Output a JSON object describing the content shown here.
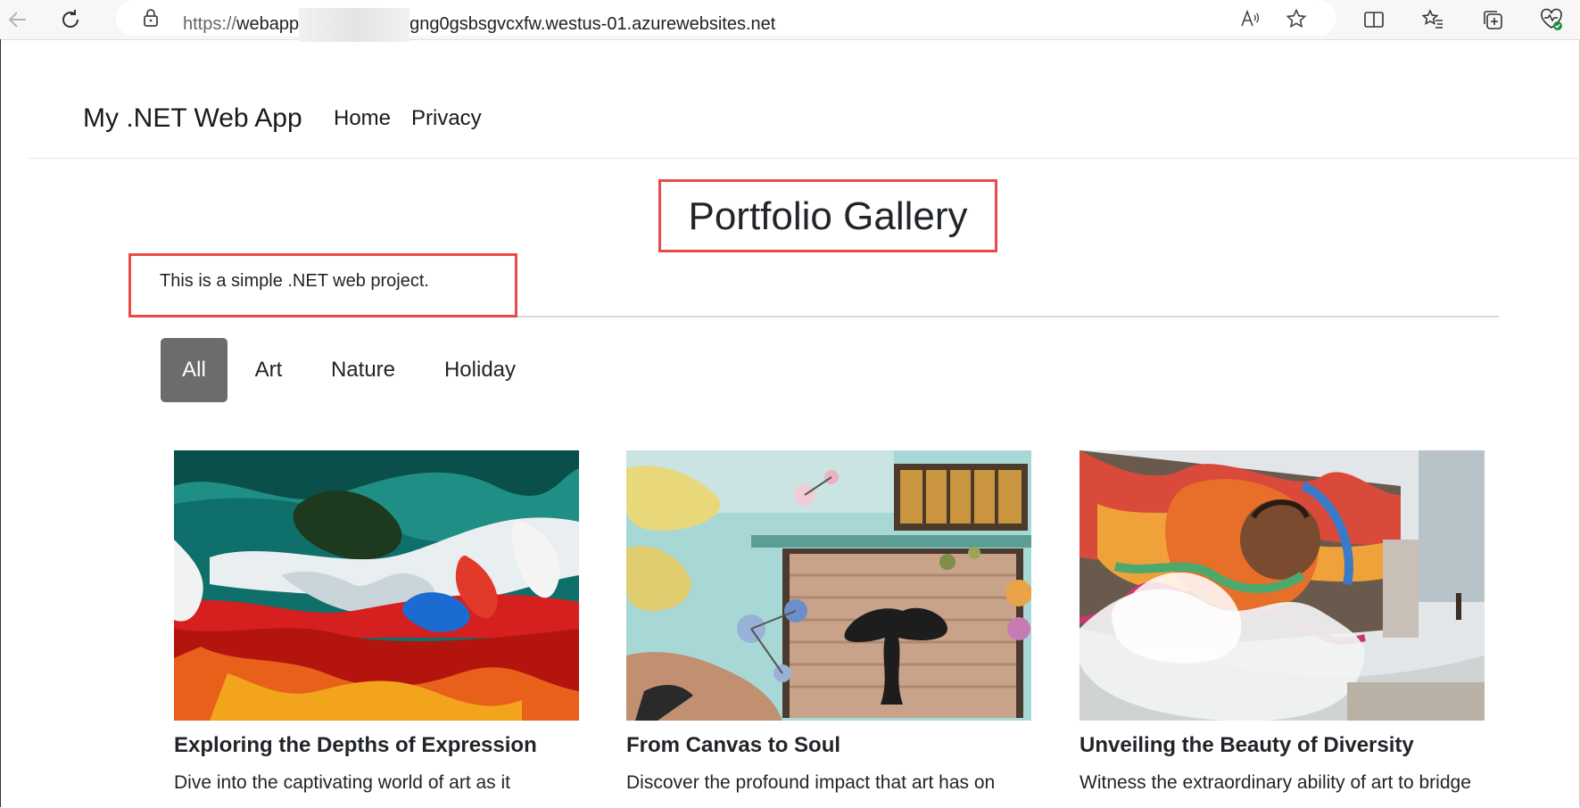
{
  "browser": {
    "url_protocol": "https://",
    "url_host_start": "webapp",
    "url_host_end": "gng0gsbsgvcxfw.westus-01.azurewebsites.net",
    "icons": [
      "back-icon",
      "refresh-icon",
      "lock-icon",
      "read-aloud-icon",
      "favorite-icon",
      "split-screen-icon",
      "favorites-icon",
      "collections-icon",
      "browser-essentials-icon"
    ]
  },
  "navbar": {
    "brand": "My .NET Web App",
    "links": [
      "Home",
      "Privacy"
    ]
  },
  "main": {
    "title": "Portfolio Gallery",
    "description": "This is a simple .NET web project."
  },
  "filters": {
    "items": [
      "All",
      "Art",
      "Nature",
      "Holiday"
    ],
    "active": "All"
  },
  "cards": [
    {
      "title": "Exploring the Depths of Expression",
      "text": "Dive into the captivating world of art as it",
      "image": "abstract-painting"
    },
    {
      "title": "From Canvas to Soul",
      "text": "Discover the profound impact that art has on",
      "image": "street-mural-garage"
    },
    {
      "title": "Unveiling the Beauty of Diversity",
      "text": "Witness the extraordinary ability of art to bridge",
      "image": "street-mural-steam"
    }
  ],
  "colors": {
    "highlight_border": "#e84a4a",
    "active_filter": "#6c6c6c"
  }
}
